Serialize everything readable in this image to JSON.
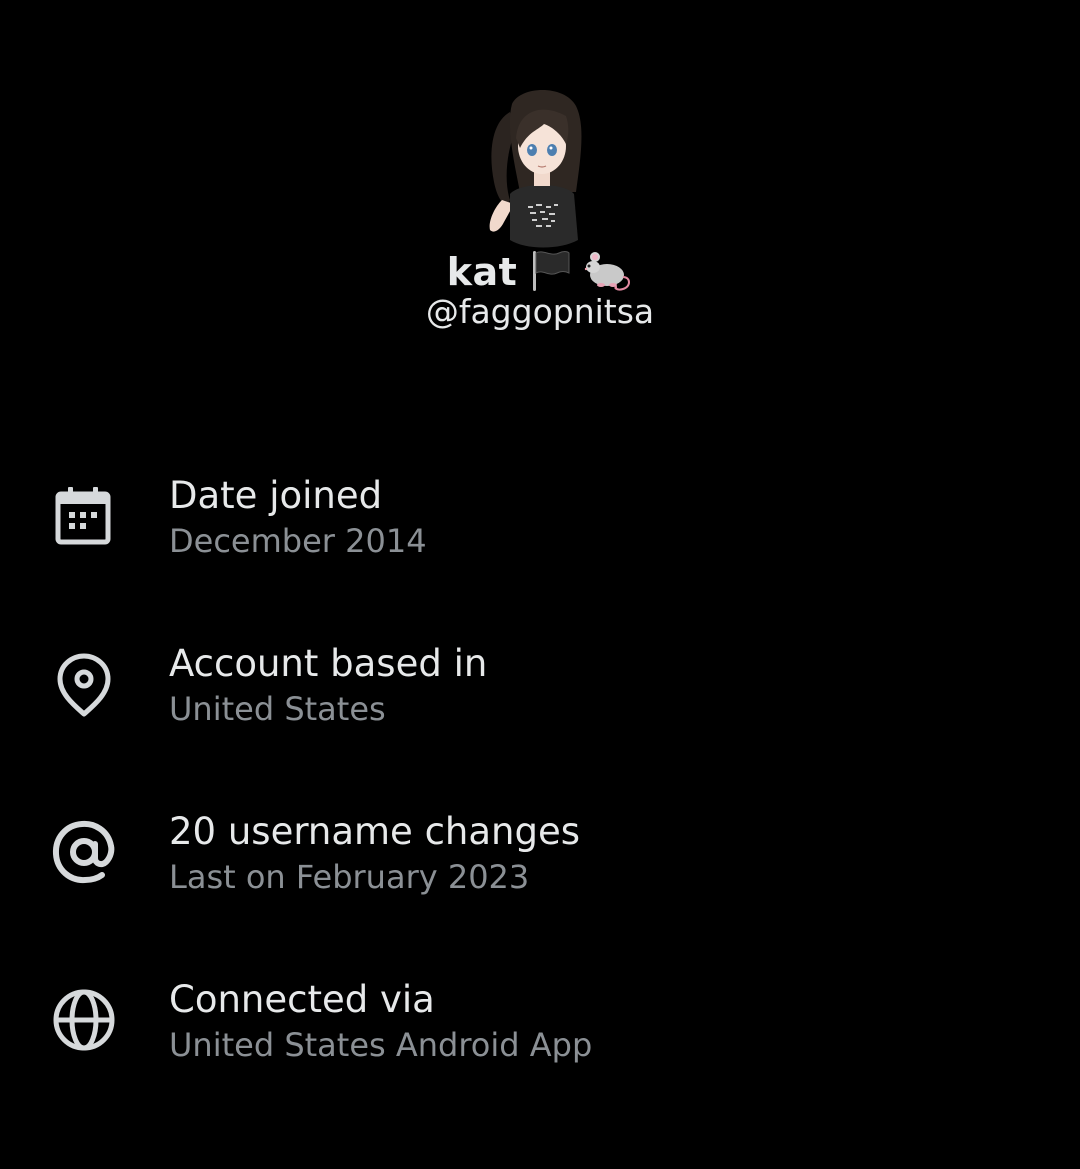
{
  "profile": {
    "display_name": "kat",
    "handle": "@faggopnitsa",
    "avatar_icon": "anime-girl-avatar",
    "name_emojis": [
      "black-flag-icon",
      "rat-icon"
    ]
  },
  "about": {
    "items": [
      {
        "icon": "calendar-icon",
        "title": "Date joined",
        "subtitle": "December 2014"
      },
      {
        "icon": "location-pin-icon",
        "title": "Account based in",
        "subtitle": "United States"
      },
      {
        "icon": "at-sign-icon",
        "title": "20 username changes",
        "subtitle": "Last on February 2023"
      },
      {
        "icon": "globe-icon",
        "title": "Connected via",
        "subtitle": "United States Android App"
      }
    ]
  },
  "colors": {
    "background": "#000000",
    "primary_text": "#e7e9ea",
    "secondary_text": "#8b9095",
    "icon": "#d6d9db"
  }
}
